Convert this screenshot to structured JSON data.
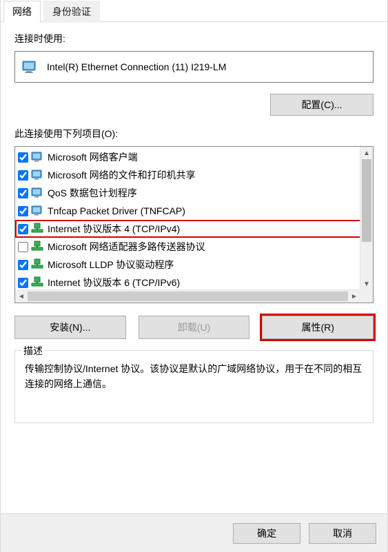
{
  "tabs": {
    "network": "网络",
    "auth": "身份验证"
  },
  "connect_using_label": "连接时使用:",
  "adapter": {
    "name": "Intel(R) Ethernet Connection (11) I219-LM"
  },
  "configure_btn": "配置(C)...",
  "items_label": "此连接使用下列项目(O):",
  "items": [
    {
      "checked": true,
      "label": "Microsoft 网络客户端",
      "icon": "svc",
      "highlight": false
    },
    {
      "checked": true,
      "label": "Microsoft 网络的文件和打印机共享",
      "icon": "svc",
      "highlight": false
    },
    {
      "checked": true,
      "label": "QoS 数据包计划程序",
      "icon": "svc",
      "highlight": false
    },
    {
      "checked": true,
      "label": "Tnfcap Packet Driver (TNFCAP)",
      "icon": "svc",
      "highlight": false
    },
    {
      "checked": true,
      "label": "Internet 协议版本 4 (TCP/IPv4)",
      "icon": "net",
      "highlight": true
    },
    {
      "checked": false,
      "label": "Microsoft 网络适配器多路传送器协议",
      "icon": "net",
      "highlight": false
    },
    {
      "checked": true,
      "label": "Microsoft LLDP 协议驱动程序",
      "icon": "net",
      "highlight": false
    },
    {
      "checked": true,
      "label": "Internet 协议版本 6 (TCP/IPv6)",
      "icon": "net",
      "highlight": false
    }
  ],
  "buttons": {
    "install": "安装(N)...",
    "uninstall": "卸载(U)",
    "properties": "属性(R)"
  },
  "description": {
    "legend": "描述",
    "text": "传输控制协议/Internet 协议。该协议是默认的广域网络协议，用于在不同的相互连接的网络上通信。"
  },
  "dialog_buttons": {
    "ok": "确定",
    "cancel": "取消"
  }
}
